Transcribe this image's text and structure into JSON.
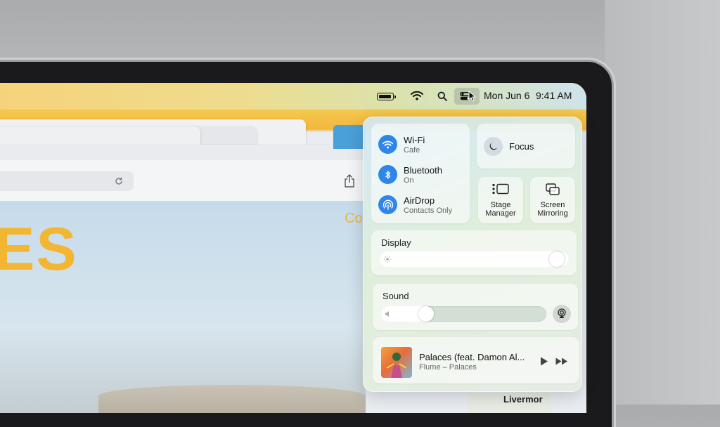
{
  "menubar": {
    "date": "Mon Jun 6",
    "time": "9:41 AM",
    "icons": [
      "battery-icon",
      "wifi-icon",
      "search-icon",
      "control-center-icon",
      "pointer-cursor-icon"
    ]
  },
  "page": {
    "hero_text": "ES",
    "hero_sub": "Co",
    "map_label": "Livermor"
  },
  "control_center": {
    "wifi": {
      "label": "Wi-Fi",
      "status": "Cafe"
    },
    "bluetooth": {
      "label": "Bluetooth",
      "status": "On"
    },
    "airdrop": {
      "label": "AirDrop",
      "status": "Contacts Only"
    },
    "focus": {
      "label": "Focus"
    },
    "stage_manager": {
      "line1": "Stage",
      "line2": "Manager"
    },
    "screen_mirroring": {
      "line1": "Screen",
      "line2": "Mirroring"
    },
    "display": {
      "label": "Display",
      "level": 0.97
    },
    "sound": {
      "label": "Sound",
      "level": 0.25
    },
    "now_playing": {
      "title": "Palaces (feat. Damon Al...",
      "subtitle": "Flume – Palaces"
    }
  },
  "colors": {
    "accent_blue": "#2f86e8",
    "hero_yellow": "#f2b632"
  }
}
